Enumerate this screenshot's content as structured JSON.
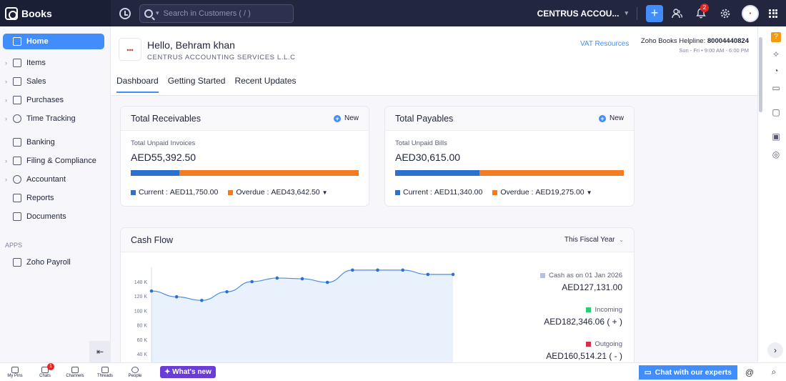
{
  "topbar": {
    "brand": "Books",
    "search_placeholder": "Search in Customers ( / )",
    "org_name": "CENTRUS ACCOU...",
    "notification_count": "2",
    "plus_label": "+"
  },
  "sidebar": {
    "items": [
      {
        "label": "Home"
      },
      {
        "label": "Items"
      },
      {
        "label": "Sales"
      },
      {
        "label": "Purchases"
      },
      {
        "label": "Time Tracking"
      },
      {
        "label": "Banking"
      },
      {
        "label": "Filing & Compliance"
      },
      {
        "label": "Accountant"
      },
      {
        "label": "Reports"
      },
      {
        "label": "Documents"
      }
    ],
    "apps_heading": "APPS",
    "apps": [
      {
        "label": "Zoho Payroll"
      }
    ]
  },
  "header": {
    "greeting": "Hello, Behram khan",
    "company": "CENTRUS ACCOUNTING SERVICES L.L.C",
    "vat_link": "VAT Resources",
    "helpline_label": "Zoho Books Helpline:",
    "helpline_number": "80004440824",
    "hours": "Sun - Fri • 9:00 AM - 6:00 PM",
    "tabs": [
      {
        "label": "Dashboard"
      },
      {
        "label": "Getting Started"
      },
      {
        "label": "Recent Updates"
      }
    ]
  },
  "receivables": {
    "title": "Total Receivables",
    "new_label": "New",
    "subtitle": "Total Unpaid Invoices",
    "amount": "AED55,392.50",
    "current_label": "Current :",
    "current_value": "AED11,750.00",
    "overdue_label": "Overdue :",
    "overdue_value": "AED43,642.50",
    "current_fraction": 0.212
  },
  "payables": {
    "title": "Total Payables",
    "new_label": "New",
    "subtitle": "Total Unpaid Bills",
    "amount": "AED30,615.00",
    "current_label": "Current :",
    "current_value": "AED11,340.00",
    "overdue_label": "Overdue :",
    "overdue_value": "AED19,275.00",
    "current_fraction": 0.37
  },
  "cashflow": {
    "title": "Cash Flow",
    "period": "This Fiscal Year",
    "cash_label": "Cash as on 01 Jan 2026",
    "cash_value": "AED127,131.00",
    "incoming_label": "Incoming",
    "incoming_value": "AED182,346.06 ( + )",
    "outgoing_label": "Outgoing",
    "outgoing_value": "AED160,514.21 ( - )"
  },
  "colors": {
    "accent": "#408dfb",
    "current": "#2a71d0",
    "overdue": "#f47b20",
    "cash": "#b9bfe0",
    "incoming": "#2ecc71",
    "outgoing": "#d0314c"
  },
  "chart_data": {
    "type": "area",
    "yticks": [
      "140 K",
      "120 K",
      "100 K",
      "80 K",
      "60 K",
      "40 K"
    ],
    "ylim": [
      40000,
      140000
    ],
    "values": [
      127000,
      119000,
      114000,
      126000,
      140000,
      145000,
      144000,
      139000,
      156000,
      156000,
      156000,
      150000,
      150000
    ]
  },
  "bottombar": {
    "items": [
      {
        "label": "My Pins"
      },
      {
        "label": "Chats",
        "badge": "1"
      },
      {
        "label": "Channels"
      },
      {
        "label": "Threads"
      },
      {
        "label": "People"
      }
    ],
    "whats_new": "What's new",
    "chat_experts": "Chat with our experts"
  }
}
